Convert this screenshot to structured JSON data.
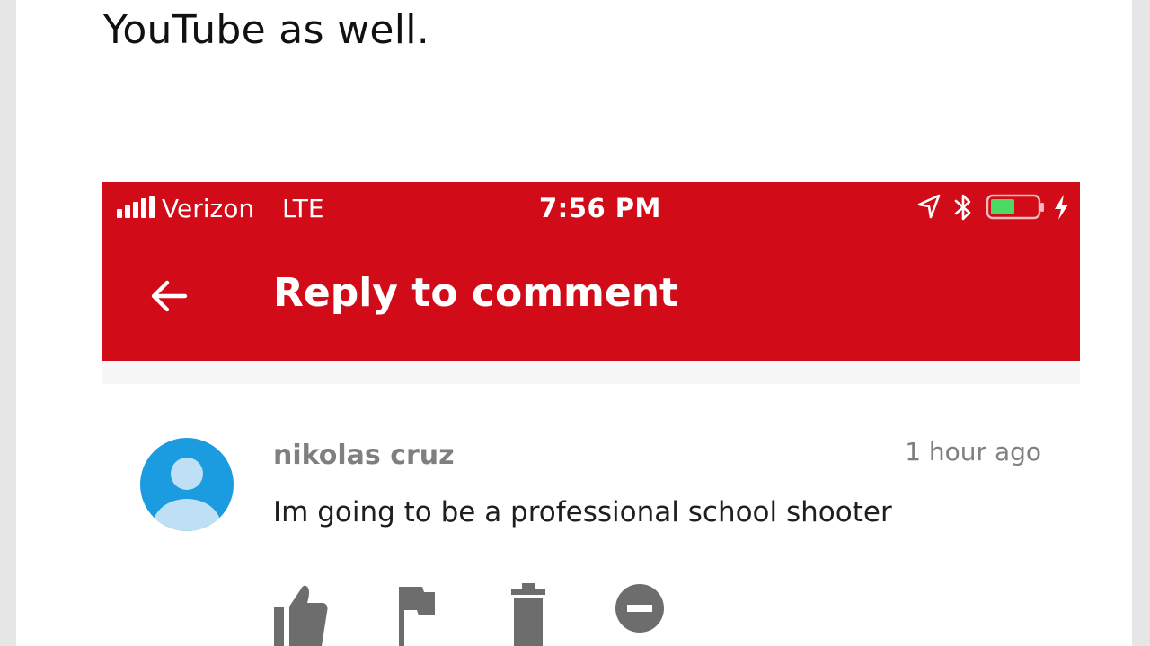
{
  "article": {
    "text": "YouTube as well."
  },
  "status_bar": {
    "carrier": "Verizon",
    "network": "LTE",
    "time": "7:56 PM",
    "icons": [
      "signal-bars-icon",
      "location-arrow-icon",
      "bluetooth-icon",
      "battery-icon",
      "charging-bolt-icon"
    ],
    "battery_fill_color": "#4cd964"
  },
  "app_bar": {
    "title": "Reply to comment",
    "background_color": "#d20b19",
    "back_icon": "arrow-back-icon"
  },
  "comment": {
    "author": "nikolas cruz",
    "timestamp": "1 hour ago",
    "text": "Im going to be a professional school shooter",
    "avatar_color": "#1b9be0",
    "avatar_icon": "default-avatar-icon"
  },
  "actions": [
    {
      "name": "like",
      "icon": "thumbs-up-icon"
    },
    {
      "name": "report",
      "icon": "flag-icon"
    },
    {
      "name": "delete",
      "icon": "trash-icon"
    },
    {
      "name": "hide",
      "icon": "minus-circle-icon"
    }
  ]
}
